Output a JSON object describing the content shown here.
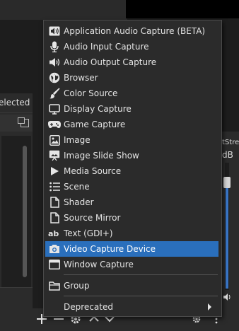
{
  "background": {
    "left_header_text": "elected",
    "right_stream_text": "tStrea",
    "right_db_text": "dB"
  },
  "menu": {
    "items": [
      {
        "label": "Application Audio Capture (BETA)",
        "icon": "app-audio-icon"
      },
      {
        "label": "Audio Input Capture",
        "icon": "microphone-icon"
      },
      {
        "label": "Audio Output Capture",
        "icon": "speaker-icon"
      },
      {
        "label": "Browser",
        "icon": "globe-icon"
      },
      {
        "label": "Color Source",
        "icon": "paintbrush-icon"
      },
      {
        "label": "Display Capture",
        "icon": "monitor-icon"
      },
      {
        "label": "Game Capture",
        "icon": "gamepad-icon"
      },
      {
        "label": "Image",
        "icon": "image-icon"
      },
      {
        "label": "Image Slide Show",
        "icon": "slideshow-icon"
      },
      {
        "label": "Media Source",
        "icon": "play-icon"
      },
      {
        "label": "Scene",
        "icon": "list-icon"
      },
      {
        "label": "Shader",
        "icon": "file-icon"
      },
      {
        "label": "Source Mirror",
        "icon": "file-icon"
      },
      {
        "label": "Text (GDI+)",
        "icon": "text-icon"
      },
      {
        "label": "Video Capture Device",
        "icon": "camera-icon",
        "selected": true
      },
      {
        "label": "Window Capture",
        "icon": "window-icon"
      }
    ],
    "group_label": "Group",
    "deprecated_label": "Deprecated"
  },
  "colors": {
    "selection": "#2a6fbc",
    "menu_bg": "#2b2b2b",
    "meter": "#3a77c8"
  }
}
